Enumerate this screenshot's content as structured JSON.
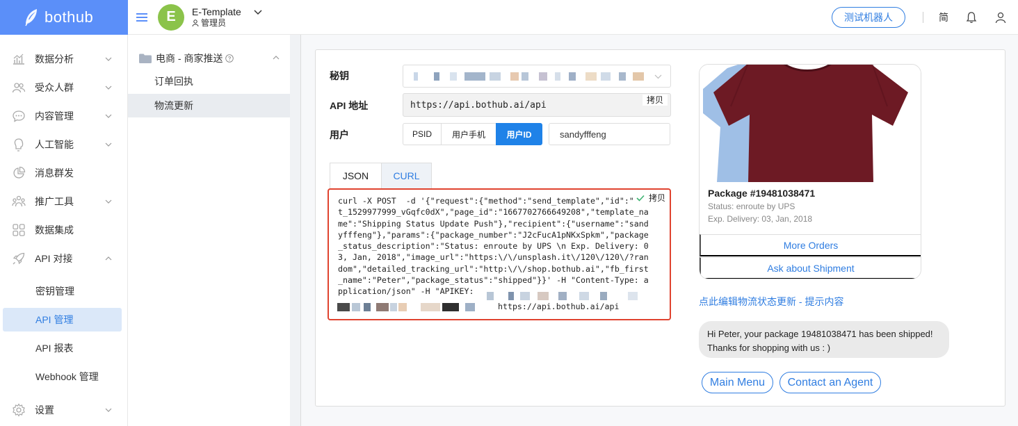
{
  "brand": {
    "logo_text": "bothub",
    "color": "#5b8ff9"
  },
  "header": {
    "bot_initial": "E",
    "bot_name": "E-Template",
    "bot_role": "管理员",
    "test_bot_label": "测试机器人",
    "lang_label": "简"
  },
  "sidebar": {
    "items": [
      {
        "label": "数据分析",
        "icon": "bar-chart-icon"
      },
      {
        "label": "受众人群",
        "icon": "users-icon"
      },
      {
        "label": "内容管理",
        "icon": "chat-icon"
      },
      {
        "label": "人工智能",
        "icon": "brain-icon"
      },
      {
        "label": "消息群发",
        "icon": "pie-chart-icon"
      },
      {
        "label": "推广工具",
        "icon": "broadcast-users-icon"
      },
      {
        "label": "数据集成",
        "icon": "grid-icon"
      },
      {
        "label": "API 对接",
        "icon": "rocket-icon"
      },
      {
        "label": "设置",
        "icon": "gear-icon"
      }
    ],
    "api_sub": [
      "密钥管理",
      "API 管理",
      "API 报表",
      "Webhook 管理"
    ],
    "accent": "#2f7de1"
  },
  "subnav": {
    "title": "电商 - 商家推送",
    "items": [
      "订单回执",
      "物流更新"
    ]
  },
  "form": {
    "secret_label": "秘钥",
    "api_url_label": "API 地址",
    "api_url": "https://api.bothub.ai/api",
    "copy_label": "拷贝",
    "user_label": "用户",
    "user_modes": [
      "PSID",
      "用户手机",
      "用户ID"
    ],
    "user_value": "sandyfffeng"
  },
  "code": {
    "tabs": [
      "JSON",
      "CURL"
    ],
    "text": "curl -X POST  -d '{\"request\":{\"method\":\"send_template\",\"id\":\"re\nt_1529977999_vGqfc0dX\",\"page_id\":\"1667702766649208\",\"template_na\nme\":\"Shipping Status Update Push\"},\"recipient\":{\"username\":\"sand\nyfffeng\"},\"params\":{\"package_number\":\"J2cFucA1pNKxSpkm\",\"package\n_status_description\":\"Status: enroute by UPS \\n Exp. Delivery: 0\n3, Jan, 2018\",\"image_url\":\"https:\\/\\/unsplash.it\\/120\\/120\\/?ran\ndom\",\"detailed_tracking_url\":\"http:\\/\\/shop.bothub.ai\",\"fb_first\n_name\":\"Peter\",\"package_status\":\"shipped\"}}' -H \"Content-Type: a\npplication/json\" -H \"APIKEY:",
    "tail": "https://api.bothub.ai/api",
    "highlight_color": "#e0432f"
  },
  "preview": {
    "package_title": "Package #19481038471",
    "status": "Status: enroute by UPS",
    "exp_delivery": "Exp. Delivery: 03, Jan, 2018",
    "more_orders": "More Orders",
    "ask_shipment": "Ask about Shipment",
    "edit_link": "点此编辑物流状态更新 - 提示内容",
    "message_line1": "Hi Peter, your package 19481038471 has been shipped!",
    "message_line2": "Thanks for shopping with us : )",
    "quick_replies": [
      "Main Menu",
      "Contact an Agent"
    ],
    "shirt_color": "#6d1a24"
  }
}
